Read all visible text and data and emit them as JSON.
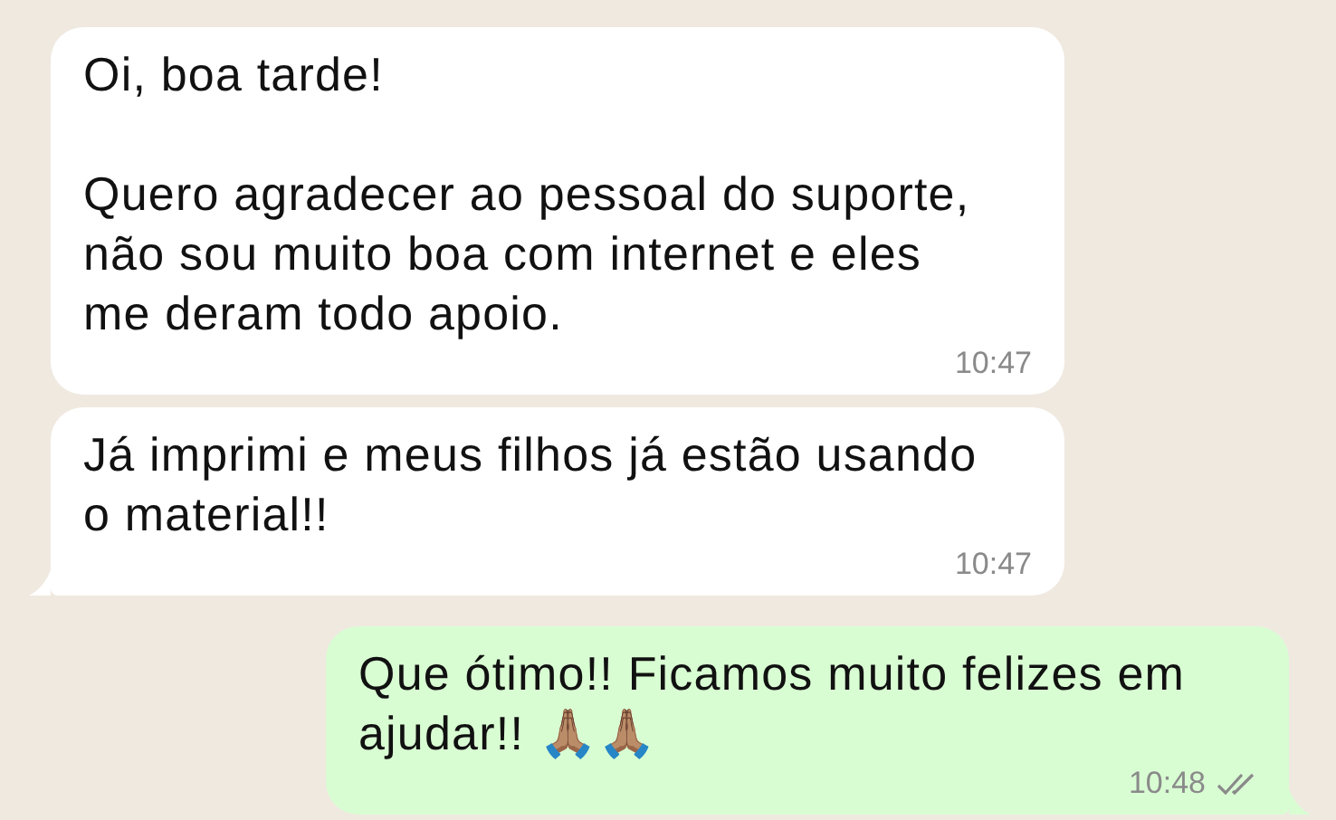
{
  "messages": [
    {
      "outgoing": false,
      "tail": false,
      "text": "Oi, boa tarde!\n\nQuero agradecer ao pessoal do suporte, não sou muito boa com internet e eles me deram todo apoio.",
      "time": "10:47"
    },
    {
      "outgoing": false,
      "tail": true,
      "text": "Já imprimi e meus filhos já estão usando o material!!",
      "time": "10:47"
    },
    {
      "outgoing": true,
      "tail": true,
      "text": "Que ótimo!! Ficamos muito felizes em ajudar!! 🙏🏽🙏🏽",
      "time": "10:48",
      "read": false
    }
  ]
}
